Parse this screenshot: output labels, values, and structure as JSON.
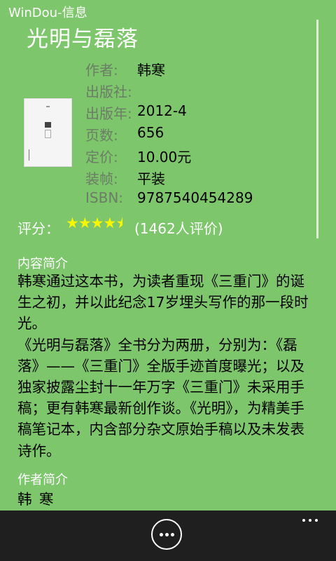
{
  "app": {
    "title": "WinDou-信息"
  },
  "book": {
    "title": "光明与磊落",
    "meta": [
      {
        "label": "作者:",
        "value": "韩寒"
      },
      {
        "label": "出版社:",
        "value": ""
      },
      {
        "label": "出版年:",
        "value": "2012-4"
      },
      {
        "label": "页数:",
        "value": "656"
      },
      {
        "label": "定价:",
        "value": "10.00元"
      },
      {
        "label": "装帧:",
        "value": "平装"
      },
      {
        "label": "ISBN:",
        "value": "9787540454289"
      }
    ],
    "rating": {
      "label": "评分：",
      "stars_value": 4.5,
      "stars_max": 5,
      "star_color": "#f7f700",
      "count_text": "(1462人评价)"
    }
  },
  "sections": {
    "intro_label": "内容简介",
    "intro_paragraphs": [
      "韩寒通过这本书，为读者重现《三重门》的诞生之初，并以此纪念17岁埋头写作的那一段时光。",
      "《光明与磊落》全书分为两册，分别为：《磊落》——《三重门》全版手迹首度曝光；以及独家披露尘封十一年万字《三重门》未采用手稿；更有韩寒最新创作谈。《光明》，为精美手稿笔记本，内含部分杂文原始手稿以及未发表诗作。"
    ],
    "author_label": "作者简介",
    "author_text": "韩 寒"
  },
  "appbar": {
    "main_button_icon": "ellipsis-circle-icon",
    "more_icon": "more-dots-icon"
  },
  "colors": {
    "background": "#7dc66b",
    "appbar": "#1f1f1f",
    "label_gray": "#6b7d66"
  }
}
